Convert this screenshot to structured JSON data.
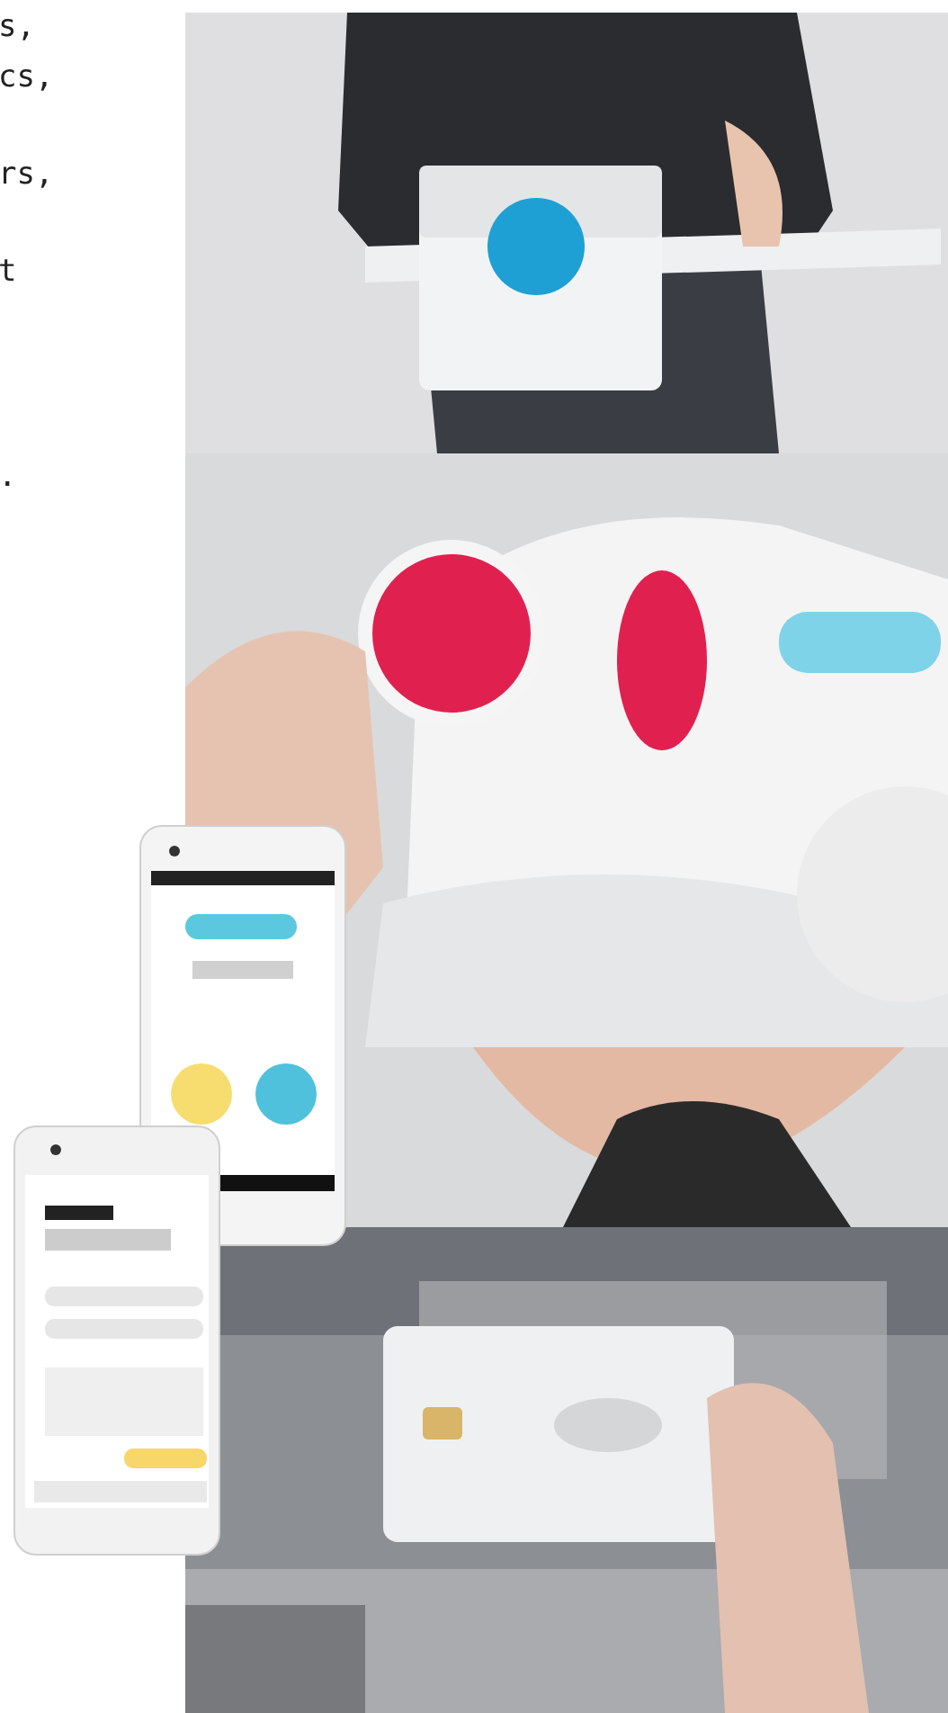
{
  "text_lines": [
    {
      "text": "s,"
    },
    {
      "text": "cs,"
    },
    {
      "text": "rs,"
    },
    {
      "text": "t"
    },
    {
      "text": "."
    }
  ]
}
